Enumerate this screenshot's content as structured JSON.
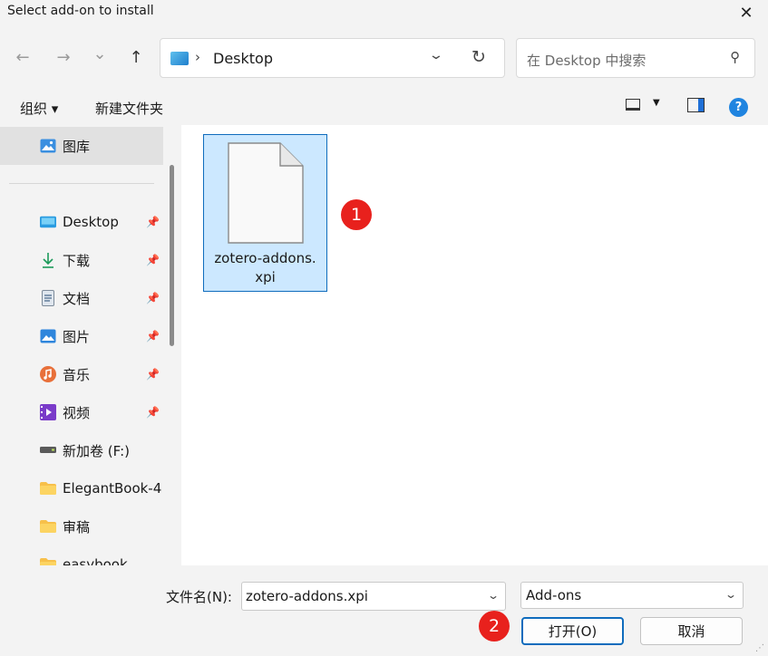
{
  "window": {
    "title": "Select add-on to install",
    "close_glyph": "✕"
  },
  "nav": {
    "back_glyph": "←",
    "forward_glyph": "→",
    "recent_glyph": "⌄",
    "up_glyph": "↑",
    "address": {
      "separator": "›",
      "location": "Desktop",
      "dropdown_glyph": "⌄",
      "refresh_glyph": "↻"
    },
    "search": {
      "placeholder": "在 Desktop 中搜索",
      "icon": "search-icon"
    }
  },
  "toolbar": {
    "organize_label": "组织 ▾",
    "new_folder_label": "新建文件夹",
    "caret": "▼",
    "help_glyph": "?"
  },
  "sidebar": {
    "gallery": {
      "label": "图库",
      "icon": "gallery-icon"
    },
    "items": [
      {
        "label": "Desktop",
        "icon": "desktop-icon",
        "pinned": true
      },
      {
        "label": "下载",
        "icon": "download-icon",
        "pinned": true
      },
      {
        "label": "文档",
        "icon": "document-icon",
        "pinned": true
      },
      {
        "label": "图片",
        "icon": "pictures-icon",
        "pinned": true
      },
      {
        "label": "音乐",
        "icon": "music-icon",
        "pinned": true
      },
      {
        "label": "视频",
        "icon": "video-icon",
        "pinned": true
      },
      {
        "label": "新加卷 (F:)",
        "icon": "drive-icon",
        "pinned": false
      },
      {
        "label": "ElegantBook-4",
        "icon": "folder-icon",
        "pinned": false
      },
      {
        "label": "审稿",
        "icon": "folder-icon",
        "pinned": false
      },
      {
        "label": "easybook",
        "icon": "folder-icon",
        "pinned": false
      }
    ],
    "pin_glyph": "📌"
  },
  "content": {
    "file": {
      "name_line1": "zotero-addons.",
      "name_line2": "xpi",
      "selected": true
    }
  },
  "annotations": {
    "badge1": "1",
    "badge2": "2",
    "color": "#e8211d"
  },
  "bottom": {
    "filename_label": "文件名(N):",
    "filename_value": "zotero-addons.xpi",
    "filetype_value": "Add-ons",
    "caret": "⌄",
    "open_label": "打开(O)",
    "cancel_label": "取消"
  },
  "colors": {
    "accent": "#0f6cbd",
    "selection": "#cce8ff"
  }
}
